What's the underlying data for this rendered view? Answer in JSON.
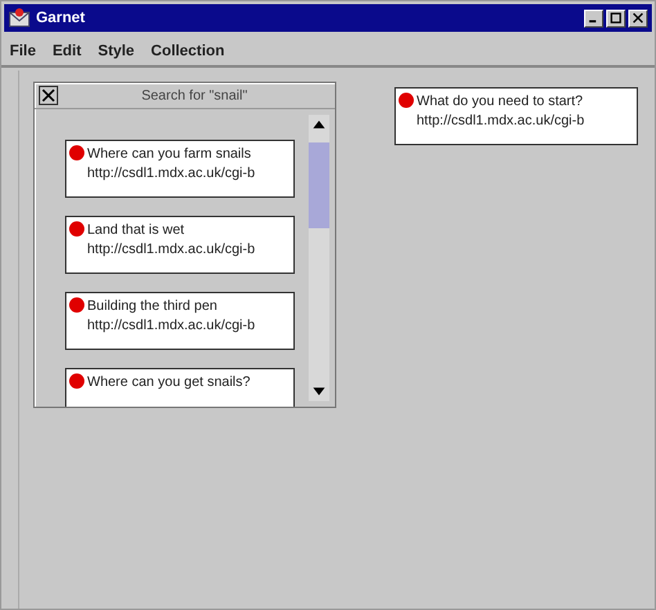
{
  "window": {
    "title": "Garnet"
  },
  "menu": [
    "File",
    "Edit",
    "Style",
    "Collection"
  ],
  "search_panel": {
    "title": "Search for \"snail\"",
    "results": [
      {
        "title": "Where can you farm snails",
        "url": "http://csdl1.mdx.ac.uk/cgi-b"
      },
      {
        "title": "Land that is wet",
        "url": "http://csdl1.mdx.ac.uk/cgi-b"
      },
      {
        "title": "Building the third pen",
        "url": "http://csdl1.mdx.ac.uk/cgi-b"
      },
      {
        "title": "Where can you get snails?"
      }
    ]
  },
  "cards": [
    {
      "title": "What do you need to start?",
      "url": "http://csdl1.mdx.ac.uk/cgi-b"
    }
  ]
}
